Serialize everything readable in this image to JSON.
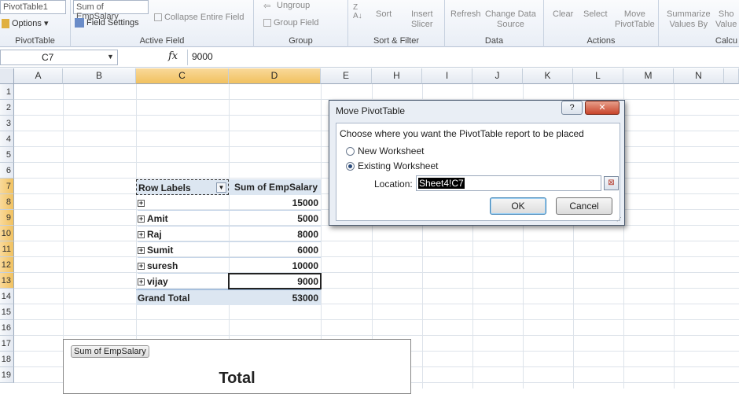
{
  "ribbon": {
    "pivot_name": "PivotTable1",
    "options_label": "Options",
    "pivot_group": "PivotTable",
    "active_field_value": "Sum of EmpSalary",
    "field_settings": "Field Settings",
    "collapse_entire_field": "Collapse Entire Field",
    "active_field_group": "Active Field",
    "ungroup": "Ungroup",
    "group_field": "Group Field",
    "group_group": "Group",
    "sort": "Sort",
    "insert_slicer": "Insert\nSlicer",
    "sort_filter_group": "Sort & Filter",
    "refresh": "Refresh",
    "change_data_source": "Change Data\nSource",
    "data_group": "Data",
    "clear": "Clear",
    "select": "Select",
    "move_pivottable": "Move\nPivotTable",
    "actions_group": "Actions",
    "summarize_values_by": "Summarize\nValues By",
    "show_values": "Sho\nValue",
    "calc_group": "Calcu"
  },
  "formula_bar": {
    "name_box": "C7",
    "fx": "fx",
    "value": "9000"
  },
  "columns": [
    "A",
    "B",
    "C",
    "D",
    "E",
    "H",
    "I",
    "J",
    "K",
    "L",
    "M",
    "N"
  ],
  "rows": [
    "1",
    "2",
    "3",
    "4",
    "5",
    "6",
    "7",
    "8",
    "9",
    "10",
    "11",
    "12",
    "13",
    "14",
    "15",
    "16",
    "17",
    "18",
    "19"
  ],
  "pivot": {
    "header_row_labels": "Row Labels",
    "header_sum": "Sum of EmpSalary",
    "items": [
      {
        "label": "",
        "value": "15000"
      },
      {
        "label": "Amit",
        "value": "5000"
      },
      {
        "label": "Raj",
        "value": "8000"
      },
      {
        "label": "Sumit",
        "value": "6000"
      },
      {
        "label": "suresh",
        "value": "10000"
      },
      {
        "label": "vijay",
        "value": "9000"
      }
    ],
    "grand_total_label": "Grand Total",
    "grand_total_value": "53000"
  },
  "dialog": {
    "title": "Move PivotTable",
    "help": "?",
    "close": "✕",
    "prompt": "Choose where you want the PivotTable report to be placed",
    "option_new": "New Worksheet",
    "option_existing": "Existing Worksheet",
    "location_label": "Location:",
    "location_value": "Sheet4!C7",
    "ok": "OK",
    "cancel": "Cancel"
  },
  "chart": {
    "field_button": "Sum of EmpSalary",
    "title": "Total"
  }
}
